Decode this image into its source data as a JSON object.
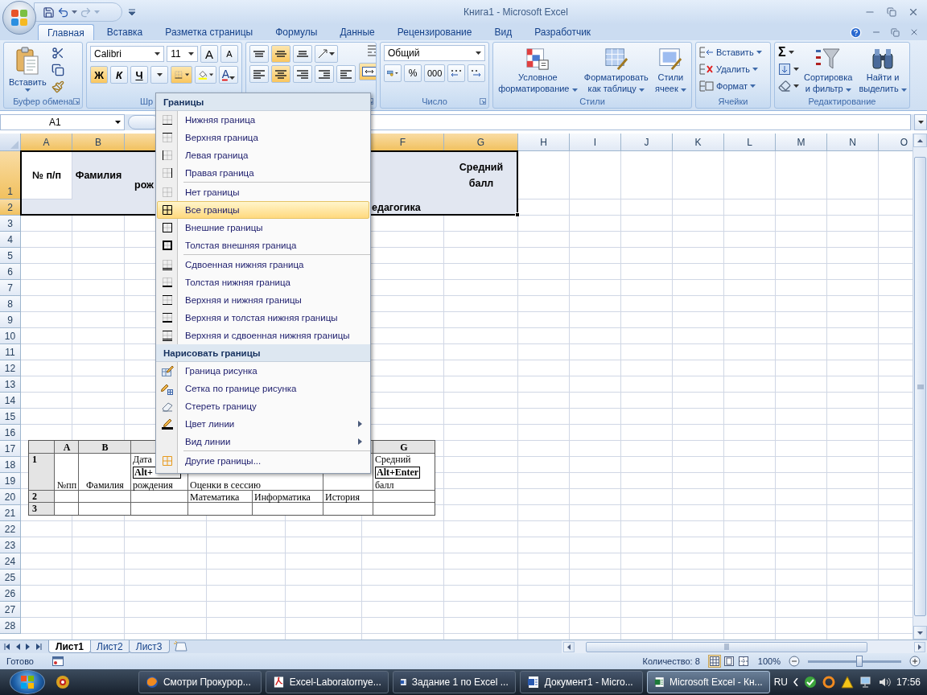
{
  "window": {
    "title": "Книга1 - Microsoft Excel"
  },
  "tabs": [
    {
      "label": "Главная",
      "selected": true
    },
    {
      "label": "Вставка",
      "selected": false
    },
    {
      "label": "Разметка страницы",
      "selected": false
    },
    {
      "label": "Формулы",
      "selected": false
    },
    {
      "label": "Данные",
      "selected": false
    },
    {
      "label": "Рецензирование",
      "selected": false
    },
    {
      "label": "Вид",
      "selected": false
    },
    {
      "label": "Разработчик",
      "selected": false
    }
  ],
  "ribbon": {
    "clipboard": {
      "paste": "Вставить",
      "label": "Буфер обмена"
    },
    "font": {
      "name": "Calibri",
      "size": "11",
      "grow": "A",
      "shrink": "A",
      "styles": [
        {
          "label": "Ж",
          "kind": "bold",
          "on": true
        },
        {
          "label": "К",
          "kind": "italic",
          "on": false
        },
        {
          "label": "Ч",
          "kind": "underline",
          "on": false
        }
      ],
      "borders_open": true,
      "font_color": "A",
      "label": "Шр"
    },
    "alignment": {
      "vertical": [
        {
          "on": false
        },
        {
          "on": true
        },
        {
          "on": false
        }
      ],
      "horizontal": [
        {
          "on": false
        },
        {
          "on": true
        },
        {
          "on": false
        }
      ],
      "merge": {
        "on": true
      }
    },
    "number": {
      "format": "Общий",
      "percent": "%",
      "thousands": "000",
      "label": "Число"
    },
    "styles": {
      "buttons": [
        {
          "lines": [
            "Условное",
            "форматирование"
          ]
        },
        {
          "lines": [
            "Форматировать",
            "как таблицу"
          ]
        },
        {
          "lines": [
            "Стили",
            "ячеек"
          ]
        }
      ],
      "label": "Стили"
    },
    "cells": {
      "buttons": [
        "Вставить",
        "Удалить",
        "Формат"
      ],
      "label": "Ячейки"
    },
    "editing": {
      "sum": "Σ",
      "buttons": [
        {
          "lines": [
            "Сортировка",
            "и фильтр"
          ]
        },
        {
          "lines": [
            "Найти и",
            "выделить"
          ]
        }
      ],
      "label": "Редактирование"
    }
  },
  "formula_bar": {
    "name_box": "A1"
  },
  "grid": {
    "columns": [
      {
        "label": "A",
        "selected": true
      },
      {
        "label": "B",
        "selected": true
      },
      {
        "selected": true
      },
      {},
      {},
      {
        "label": "F",
        "selected": true
      },
      {
        "label": "G",
        "selected": true
      },
      {
        "label": "H",
        "selected": false
      },
      {
        "label": "I",
        "selected": false
      },
      {
        "label": "J",
        "selected": false
      },
      {
        "label": "K",
        "selected": false
      },
      {
        "label": "L",
        "selected": false
      },
      {
        "label": "M",
        "selected": false
      },
      {
        "label": "N",
        "selected": false
      },
      {
        "label": "O",
        "selected": false
      }
    ],
    "rows": [
      {
        "label": "1",
        "selected": true,
        "cells": [
          {
            "text": "№ п/п",
            "active": true
          },
          {
            "text": "Фамилия"
          },
          {
            "text": "рож"
          },
          {},
          {},
          {},
          {
            "text": "Средний балл"
          }
        ]
      },
      {
        "label": "2",
        "selected": true,
        "cells": [
          {},
          {},
          {},
          {},
          {},
          {
            "text": "едагогика"
          }
        ]
      },
      {
        "label": "3",
        "selected": false
      },
      {
        "label": "4",
        "selected": false
      },
      {
        "label": "5",
        "selected": false
      },
      {
        "label": "6",
        "selected": false
      },
      {
        "label": "7",
        "selected": false
      },
      {
        "label": "8",
        "selected": false
      },
      {
        "label": "9",
        "selected": false
      },
      {
        "label": "10",
        "selected": false
      },
      {
        "label": "11",
        "selected": false
      },
      {
        "label": "12",
        "selected": false
      },
      {
        "label": "13",
        "selected": false
      },
      {
        "label": "14",
        "selected": false
      },
      {
        "label": "15",
        "selected": false
      },
      {
        "label": "16",
        "selected": false
      },
      {
        "label": "17",
        "selected": false
      },
      {
        "label": "18",
        "selected": false
      },
      {
        "label": "19",
        "selected": false
      },
      {
        "label": "20",
        "selected": false
      },
      {
        "label": "21",
        "selected": false
      },
      {
        "label": "22",
        "selected": false
      },
      {
        "label": "23",
        "selected": false
      },
      {
        "label": "24",
        "selected": false
      },
      {
        "label": "25",
        "selected": false
      },
      {
        "label": "26",
        "selected": false
      },
      {
        "label": "27",
        "selected": false
      },
      {
        "label": "28",
        "selected": false
      }
    ]
  },
  "embedded_table": {
    "rows": [
      {
        "kind": "header",
        "cells": [
          {
            "text": "A"
          },
          {
            "text": "B"
          },
          {},
          {},
          {},
          {},
          {
            "text": "G"
          }
        ]
      },
      {
        "kind": "data",
        "label": "1",
        "cells": [
          {
            "parts": [
              {
                "text": "№пп",
                "kind": "plain"
              }
            ]
          },
          {
            "parts": [
              {
                "text": "Фамилия",
                "kind": "plain"
              }
            ]
          },
          {
            "parts": [
              {
                "text": "Дата",
                "kind": "plain"
              },
              {
                "text": "Alt+",
                "kind": "key"
              },
              {
                "text": "рождения",
                "kind": "plain"
              }
            ]
          },
          {
            "merged": true,
            "parts": [
              {
                "text": "Оценки в сессию",
                "kind": "plain"
              }
            ]
          },
          {},
          {},
          {
            "parts": [
              {
                "text": "Средний",
                "kind": "plain"
              },
              {
                "text": "Alt+Enter",
                "kind": "key"
              },
              {
                "text": "балл",
                "kind": "plain"
              }
            ]
          }
        ]
      },
      {
        "kind": "data",
        "label": "2",
        "cells": [
          {},
          {},
          {},
          {
            "parts": [
              {
                "text": "Математика",
                "kind": "plain"
              }
            ]
          },
          {
            "parts": [
              {
                "text": "Информатика",
                "kind": "plain"
              }
            ]
          },
          {
            "parts": [
              {
                "text": "История",
                "kind": "plain"
              }
            ]
          },
          {}
        ]
      },
      {
        "kind": "data",
        "label": "3"
      }
    ]
  },
  "border_menu": {
    "sections": [
      {
        "header": "Границы",
        "groups": [
          [
            {
              "label": "Нижняя граница",
              "selected": false,
              "submenu": false
            },
            {
              "label": "Верхняя граница",
              "selected": false,
              "submenu": false
            },
            {
              "label": "Левая граница",
              "selected": false,
              "submenu": false
            },
            {
              "label": "Правая граница",
              "selected": false,
              "submenu": false
            }
          ],
          [
            {
              "label": "Нет границы",
              "selected": false,
              "submenu": false
            },
            {
              "label": "Все границы",
              "selected": true,
              "submenu": false
            },
            {
              "label": "Внешние границы",
              "selected": false,
              "submenu": false
            },
            {
              "label": "Толстая внешняя граница",
              "selected": false,
              "submenu": false
            }
          ],
          [
            {
              "label": "Сдвоенная нижняя граница",
              "selected": false,
              "submenu": false
            },
            {
              "label": "Толстая нижняя граница",
              "selected": false,
              "submenu": false
            },
            {
              "label": "Верхняя и нижняя границы",
              "selected": false,
              "submenu": false
            },
            {
              "label": "Верхняя и толстая нижняя границы",
              "selected": false,
              "submenu": false
            },
            {
              "label": "Верхняя и сдвоенная нижняя границы",
              "selected": false,
              "submenu": false
            }
          ]
        ]
      },
      {
        "header": "Нарисовать границы",
        "groups": [
          [
            {
              "label": "Граница рисунка",
              "selected": false,
              "submenu": false
            },
            {
              "label": "Сетка по границе рисунка",
              "selected": false,
              "submenu": false
            },
            {
              "label": "Стереть границу",
              "selected": false,
              "submenu": false
            },
            {
              "label": "Цвет линии",
              "selected": false,
              "submenu": true
            },
            {
              "label": "Вид линии",
              "selected": false,
              "submenu": true
            }
          ],
          [
            {
              "label": "Другие границы...",
              "selected": false,
              "submenu": false
            }
          ]
        ]
      }
    ]
  },
  "sheet_tabs": [
    {
      "label": "Лист1",
      "selected": true
    },
    {
      "label": "Лист2",
      "selected": false
    },
    {
      "label": "Лист3",
      "selected": false
    }
  ],
  "status_bar": {
    "ready": "Готово",
    "count": "Количество: 8",
    "views": [
      {
        "selected": true
      },
      {
        "selected": false
      },
      {
        "selected": false
      }
    ],
    "zoom": "100%",
    "zoom_slider": {
      "level": 0.55
    }
  },
  "taskbar": {
    "tasks": [
      {
        "label": "Смотри Прокурор...",
        "selected": false
      },
      {
        "label": "Excel-Laboratornye...",
        "selected": false
      },
      {
        "label": "Задание 1 по Excel ...",
        "selected": false
      },
      {
        "label": "Документ1 - Micro...",
        "selected": false
      },
      {
        "label": "Microsoft Excel - Кн...",
        "selected": true
      }
    ],
    "language": "RU",
    "clock": "17:56"
  }
}
